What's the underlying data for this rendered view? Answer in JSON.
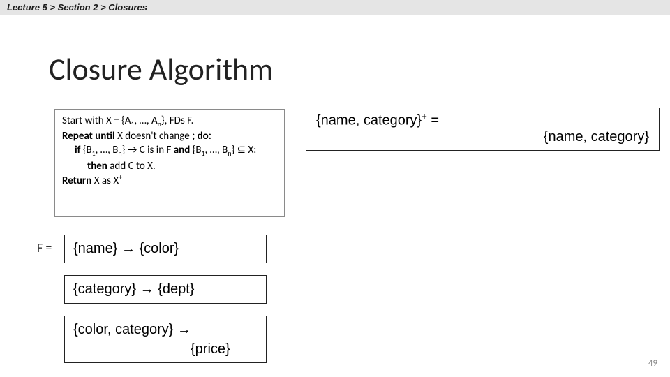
{
  "breadcrumb": {
    "part1": "Lecture 5",
    "part2": "Section 2",
    "part3": "Closures",
    "sep": ">"
  },
  "title": "Closure Algorithm",
  "algorithm": {
    "start_text": "Start with X = {A",
    "start_text2": ", …, A",
    "start_text3": "}, FDs F.",
    "repeat_bold": "Repeat until",
    "repeat_rest": " X doesn't change ",
    "do_bold": "; do:",
    "if_bold": "if",
    "if_text": " {B",
    "if_text2": ", …, B",
    "if_text3": "} ",
    "arrow": "→",
    "if_text4": " C is in F ",
    "and_bold": "and",
    "if_text5": " {B",
    "if_text6": ", …, B",
    "if_text7": "} ⊆ X:",
    "then_bold": "then",
    "then_text": "  add C to X.",
    "return_bold": "Return",
    "return_text": " X as X",
    "sub1": "1",
    "subn": "n",
    "supplus": "+"
  },
  "closure": {
    "line1a": "{name, category}",
    "line1sup": "+",
    "line1b": " =",
    "line2": "{name, category}"
  },
  "f_label": "F =",
  "fds": {
    "fd1": "{name} → {color}",
    "fd2": "{category} → {dept}",
    "fd3a": "{color, category} →",
    "fd3b": "{price}"
  },
  "page_number": "49"
}
